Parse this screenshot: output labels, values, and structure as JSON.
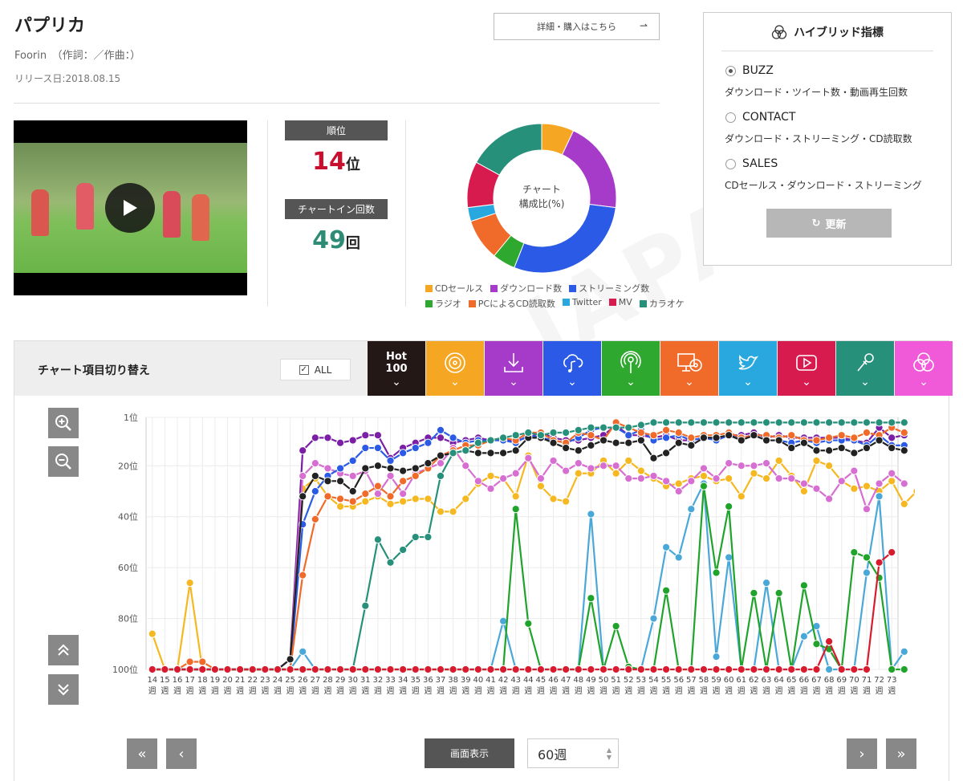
{
  "song": {
    "title": "パプリカ",
    "artist_line": "Foorin　（作詞：／作曲：）",
    "release": "リリース日:2018.08.15",
    "detail_button": "詳細・購入はこちら"
  },
  "rank": {
    "rank_label": "順位",
    "rank_value": "14",
    "rank_unit": "位",
    "rank_color": "#c8102e",
    "count_label": "チャートイン回数",
    "count_value": "49",
    "count_unit": "回",
    "count_color": "#2e8b76"
  },
  "donut": {
    "center_line1": "チャート",
    "center_line2": "構成比(%)",
    "segments": [
      {
        "name": "CDセールス",
        "color": "#f5a623",
        "value": 7
      },
      {
        "name": "ダウンロード数",
        "color": "#a63ac9",
        "value": 20
      },
      {
        "name": "ストリーミング数",
        "color": "#2b5be6",
        "value": 29
      },
      {
        "name": "ラジオ",
        "color": "#2ea82e",
        "value": 5
      },
      {
        "name": "PCによるCD読取数",
        "color": "#f06a2a",
        "value": 9
      },
      {
        "name": "Twitter",
        "color": "#29a8e0",
        "value": 3
      },
      {
        "name": "MV",
        "color": "#d81b4f",
        "value": 10
      },
      {
        "name": "カラオケ",
        "color": "#26907a",
        "value": 17
      }
    ],
    "legend_row1": [
      "CDセールス",
      "ダウンロード数",
      "ストリーミング数"
    ],
    "legend_row2": [
      "ラジオ",
      "PCによるCD読取数",
      "Twitter",
      "MV",
      "カラオケ"
    ]
  },
  "hybrid": {
    "title": "ハイブリッド指標",
    "options": [
      {
        "label": "BUZZ",
        "desc": "ダウンロード・ツイート数・動画再生回数",
        "selected": true
      },
      {
        "label": "CONTACT",
        "desc": "ダウンロード・ストリーミング・CD読取数",
        "selected": false
      },
      {
        "label": "SALES",
        "desc": "CDセールス・ダウンロード・ストリーミング",
        "selected": false
      }
    ],
    "update_button": "更新"
  },
  "toolbar": {
    "label": "チャート項目切り替え",
    "all_label": "ALL",
    "hot_line1": "Hot",
    "hot_line2": "100",
    "tabs": [
      {
        "name": "hot100",
        "color": "#231815",
        "icon": "hot-100"
      },
      {
        "name": "cd-sales",
        "color": "#f5a623",
        "icon": "cd-icon"
      },
      {
        "name": "download",
        "color": "#a63ac9",
        "icon": "download-icon"
      },
      {
        "name": "streaming",
        "color": "#2b5be6",
        "icon": "cloud-music-icon"
      },
      {
        "name": "radio",
        "color": "#2ea82e",
        "icon": "radio-icon"
      },
      {
        "name": "pc-cd-read",
        "color": "#f06a2a",
        "icon": "pc-cd-icon"
      },
      {
        "name": "twitter",
        "color": "#29a8e0",
        "icon": "twitter-icon"
      },
      {
        "name": "mv",
        "color": "#d81b4f",
        "icon": "play-icon"
      },
      {
        "name": "karaoke",
        "color": "#26907a",
        "icon": "microphone-icon"
      },
      {
        "name": "hybrid",
        "color": "#f05ad8",
        "icon": "hybrid-icon"
      }
    ]
  },
  "controls": {
    "display_button": "画面表示",
    "weeks_select": "60週"
  },
  "chart_data": {
    "type": "line",
    "y_inverted": true,
    "ylim": [
      100,
      1
    ],
    "yticks": [
      "1位",
      "20位",
      "40位",
      "60位",
      "80位",
      "100位"
    ],
    "ytick_values": [
      1,
      20,
      40,
      60,
      80,
      100
    ],
    "x_numbers": [
      "14",
      "15",
      "16",
      "17",
      "18",
      "19",
      "20",
      "21",
      "22",
      "23",
      "24",
      "25",
      "26",
      "27",
      "28",
      "29",
      "30",
      "31",
      "32",
      "33",
      "34",
      "35",
      "36",
      "37",
      "38",
      "39",
      "40",
      "41",
      "42",
      "43",
      "44",
      "45",
      "46",
      "47",
      "48",
      "49",
      "50",
      "51",
      "52",
      "53",
      "54",
      "55",
      "56",
      "57",
      "58",
      "59",
      "60",
      "61",
      "62",
      "63",
      "64",
      "65",
      "66",
      "67",
      "68",
      "69",
      "70",
      "71",
      "72",
      "73"
    ],
    "x_unit": "週",
    "series": [
      {
        "key": "cd",
        "color": "#f5b820",
        "values": [
          86,
          100,
          100,
          66,
          100,
          100,
          100,
          100,
          100,
          100,
          100,
          100,
          29,
          25,
          32,
          36,
          36,
          34,
          32,
          35,
          34,
          33,
          33,
          38,
          38,
          33,
          27,
          24,
          25,
          32,
          16,
          28,
          33,
          34,
          23,
          23,
          18,
          23,
          18,
          22,
          25,
          28,
          27,
          25,
          24,
          26,
          25,
          32,
          23,
          25,
          18,
          24,
          30,
          18,
          20,
          26,
          29,
          28,
          30,
          26,
          35,
          30
        ]
      },
      {
        "key": "download",
        "color": "#7a1fa6",
        "values": [
          100,
          100,
          100,
          100,
          100,
          100,
          100,
          100,
          100,
          100,
          100,
          96,
          14,
          9,
          9,
          11,
          10,
          8,
          8,
          17,
          13,
          11,
          9,
          9,
          11,
          10,
          9,
          10,
          10,
          10,
          9,
          7,
          9,
          10,
          10,
          9,
          8,
          4,
          8,
          8,
          9,
          8,
          10,
          10,
          9,
          9,
          8,
          8,
          7,
          9,
          8,
          9,
          9,
          9,
          9,
          9,
          10,
          11,
          5,
          9,
          8
        ]
      },
      {
        "key": "pink",
        "color": "#d66fd1",
        "values": [
          100,
          100,
          100,
          100,
          100,
          100,
          100,
          100,
          100,
          100,
          100,
          96,
          24,
          19,
          21,
          23,
          24,
          22,
          31,
          24,
          31,
          23,
          21,
          19,
          13,
          20,
          26,
          29,
          25,
          23,
          17,
          25,
          18,
          22,
          19,
          21,
          20,
          20,
          25,
          25,
          24,
          26,
          30,
          26,
          21,
          25,
          19,
          20,
          20,
          19,
          25,
          25,
          27,
          29,
          33,
          26,
          22,
          37,
          27,
          23,
          27
        ]
      },
      {
        "key": "streaming",
        "color": "#2b5be6",
        "values": [
          100,
          100,
          100,
          100,
          100,
          100,
          100,
          100,
          100,
          100,
          100,
          100,
          43,
          30,
          24,
          21,
          18,
          13,
          13,
          18,
          15,
          13,
          11,
          6,
          9,
          11,
          10,
          10,
          10,
          11,
          8,
          9,
          10,
          11,
          9,
          6,
          5,
          5,
          8,
          6,
          10,
          9,
          8,
          10,
          9,
          10,
          8,
          9,
          8,
          10,
          10,
          11,
          10,
          11,
          10,
          10,
          10,
          12,
          8,
          12,
          12
        ]
      },
      {
        "key": "orange",
        "color": "#f06a2a",
        "values": [
          100,
          100,
          100,
          97,
          97,
          100,
          100,
          100,
          100,
          100,
          100,
          100,
          63,
          41,
          32,
          33,
          34,
          31,
          28,
          32,
          26,
          24,
          21,
          16,
          14,
          12,
          12,
          10,
          9,
          10,
          7,
          7,
          10,
          11,
          7,
          8,
          10,
          3,
          5,
          7,
          8,
          6,
          7,
          9,
          8,
          8,
          7,
          9,
          8,
          8,
          9,
          8,
          10,
          10,
          9,
          8,
          9,
          7,
          8,
          5,
          7
        ]
      },
      {
        "key": "hot100",
        "color": "#222222",
        "values": [
          100,
          100,
          100,
          100,
          100,
          100,
          100,
          100,
          100,
          100,
          100,
          96,
          32,
          24,
          26,
          26,
          30,
          21,
          20,
          21,
          22,
          21,
          19,
          16,
          15,
          14,
          15,
          15,
          15,
          14,
          9,
          9,
          11,
          13,
          14,
          12,
          10,
          11,
          11,
          10,
          17,
          15,
          11,
          12,
          9,
          9,
          8,
          10,
          8,
          10,
          10,
          13,
          11,
          14,
          14,
          13,
          15,
          13,
          10,
          13,
          14
        ]
      },
      {
        "key": "karaoke",
        "color": "#26907a",
        "values": [
          100,
          100,
          100,
          100,
          100,
          100,
          100,
          100,
          100,
          100,
          100,
          100,
          100,
          100,
          100,
          100,
          100,
          75,
          49,
          58,
          53,
          48,
          48,
          24,
          15,
          14,
          11,
          10,
          9,
          8,
          7,
          8,
          7,
          7,
          6,
          5,
          5,
          5,
          5,
          4,
          3,
          3,
          3,
          3,
          3,
          3,
          3,
          3,
          3,
          3,
          3,
          3,
          3,
          3,
          3,
          3,
          3,
          3,
          3,
          3,
          3
        ]
      },
      {
        "key": "twitter",
        "color": "#4aa8d8",
        "values": [
          100,
          100,
          100,
          100,
          100,
          100,
          100,
          100,
          100,
          100,
          100,
          100,
          93,
          100,
          100,
          100,
          100,
          100,
          100,
          100,
          100,
          100,
          100,
          100,
          100,
          100,
          100,
          100,
          81,
          100,
          100,
          100,
          100,
          100,
          100,
          39,
          100,
          100,
          100,
          100,
          80,
          52,
          56,
          37,
          27,
          95,
          56,
          100,
          100,
          66,
          100,
          100,
          87,
          83,
          100,
          100,
          100,
          62,
          32,
          100,
          93
        ]
      },
      {
        "key": "radio",
        "color": "#1fa32a",
        "values": [
          100,
          100,
          100,
          100,
          100,
          100,
          100,
          100,
          100,
          100,
          100,
          100,
          100,
          100,
          100,
          100,
          100,
          100,
          100,
          100,
          100,
          100,
          100,
          100,
          100,
          100,
          100,
          100,
          100,
          37,
          82,
          100,
          100,
          100,
          100,
          72,
          100,
          83,
          99,
          100,
          100,
          69,
          100,
          100,
          28,
          62,
          36,
          100,
          70,
          100,
          70,
          100,
          67,
          90,
          92,
          100,
          54,
          56,
          64,
          100,
          100
        ]
      },
      {
        "key": "mv",
        "color": "#d81b2e",
        "values": [
          100,
          100,
          100,
          100,
          100,
          100,
          100,
          100,
          100,
          100,
          100,
          100,
          100,
          100,
          100,
          100,
          100,
          100,
          100,
          100,
          100,
          100,
          100,
          100,
          100,
          100,
          100,
          100,
          100,
          100,
          100,
          100,
          100,
          100,
          100,
          100,
          100,
          100,
          100,
          100,
          100,
          100,
          100,
          100,
          100,
          100,
          100,
          100,
          100,
          100,
          100,
          100,
          100,
          100,
          89,
          100,
          100,
          100,
          58,
          54
        ]
      }
    ]
  }
}
